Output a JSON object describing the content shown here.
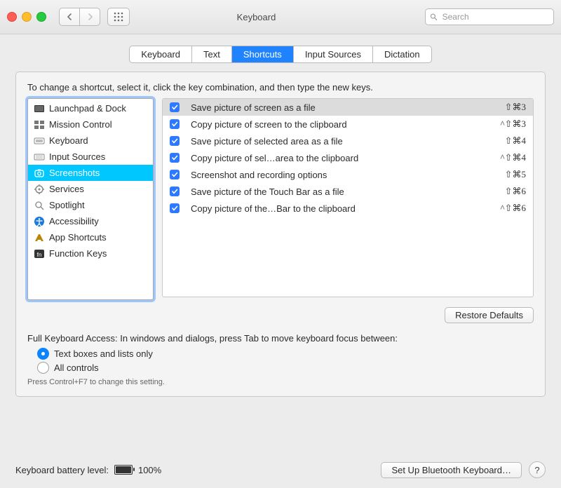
{
  "window": {
    "title": "Keyboard"
  },
  "toolbar": {
    "search_placeholder": "Search"
  },
  "tabs": {
    "items": [
      "Keyboard",
      "Text",
      "Shortcuts",
      "Input Sources",
      "Dictation"
    ],
    "active_index": 2
  },
  "pane": {
    "instruction": "To change a shortcut, select it, click the key combination, and then type the new keys.",
    "categories": [
      {
        "icon": "launchpad",
        "label": "Launchpad & Dock"
      },
      {
        "icon": "mission",
        "label": "Mission Control"
      },
      {
        "icon": "keyboard",
        "label": "Keyboard"
      },
      {
        "icon": "input",
        "label": "Input Sources"
      },
      {
        "icon": "screenshot",
        "label": "Screenshots"
      },
      {
        "icon": "services",
        "label": "Services"
      },
      {
        "icon": "spotlight",
        "label": "Spotlight"
      },
      {
        "icon": "accessibility",
        "label": "Accessibility"
      },
      {
        "icon": "appshortcuts",
        "label": "App Shortcuts"
      },
      {
        "icon": "fn",
        "label": "Function Keys"
      }
    ],
    "selected_category_index": 4,
    "shortcuts": [
      {
        "checked": true,
        "label": "Save picture of screen as a file",
        "keys": "⇧⌘3",
        "selected": true
      },
      {
        "checked": true,
        "label": "Copy picture of screen to the clipboard",
        "keys": "^⇧⌘3"
      },
      {
        "checked": true,
        "label": "Save picture of selected area as a file",
        "keys": "⇧⌘4"
      },
      {
        "checked": true,
        "label": "Copy picture of sel…area to the clipboard",
        "keys": "^⇧⌘4"
      },
      {
        "checked": true,
        "label": "Screenshot and recording options",
        "keys": "⇧⌘5"
      },
      {
        "checked": true,
        "label": "Save picture of the Touch Bar as a file",
        "keys": "⇧⌘6"
      },
      {
        "checked": true,
        "label": "Copy picture of the…Bar to the clipboard",
        "keys": "^⇧⌘6"
      }
    ],
    "restore_label": "Restore Defaults"
  },
  "keyboard_access": {
    "heading": "Full Keyboard Access: In windows and dialogs, press Tab to move keyboard focus between:",
    "options": [
      "Text boxes and lists only",
      "All controls"
    ],
    "selected_index": 0,
    "hint": "Press Control+F7 to change this setting."
  },
  "footer": {
    "battery_label": "Keyboard battery level:",
    "battery_pct": "100%",
    "bluetooth_label": "Set Up Bluetooth Keyboard…",
    "help": "?"
  }
}
